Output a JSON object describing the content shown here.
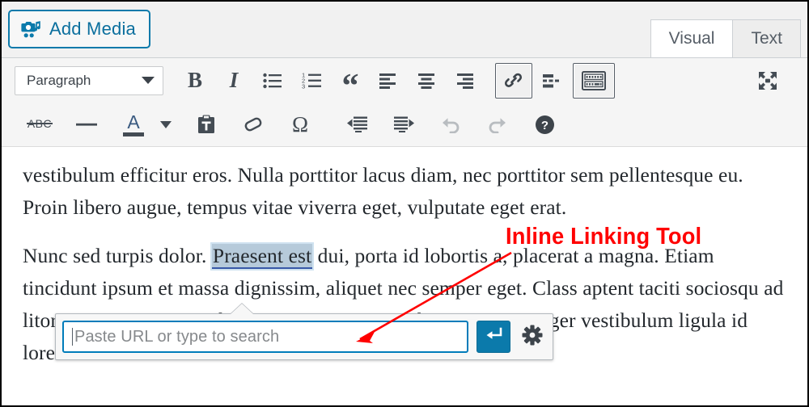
{
  "window": {
    "app": "WordPress Classic Editor"
  },
  "topbar": {
    "add_media_label": "Add Media",
    "add_media_icon": "camera-music-icon",
    "accent_color": "#0b7aab",
    "tabs": [
      {
        "label": "Visual",
        "active": true
      },
      {
        "label": "Text",
        "active": false
      }
    ]
  },
  "toolbar": {
    "style_select": {
      "value": "Paragraph",
      "caret_icon": "chevron-down-icon"
    },
    "row1": [
      {
        "name": "bold-button",
        "icon": "bold-icon",
        "glyph": "B",
        "active": false
      },
      {
        "name": "italic-button",
        "icon": "italic-icon",
        "glyph": "I",
        "active": false
      },
      {
        "name": "bulleted-list-button",
        "icon": "bulleted-list-icon",
        "active": false
      },
      {
        "name": "numbered-list-button",
        "icon": "numbered-list-icon",
        "active": false
      },
      {
        "name": "blockquote-button",
        "icon": "quote-icon",
        "glyph": "“",
        "active": false
      },
      {
        "name": "align-left-button",
        "icon": "align-left-icon",
        "active": false
      },
      {
        "name": "align-center-button",
        "icon": "align-center-icon",
        "active": false
      },
      {
        "name": "align-right-button",
        "icon": "align-right-icon",
        "active": false
      },
      {
        "name": "insert-link-button",
        "icon": "link-icon",
        "active": true
      },
      {
        "name": "read-more-button",
        "icon": "read-more-icon",
        "active": false
      },
      {
        "name": "toolbar-toggle-button",
        "icon": "keyboard-toolbar-icon",
        "active": true
      },
      {
        "name": "fullscreen-button",
        "icon": "distraction-free-icon",
        "active": false
      }
    ],
    "row2": [
      {
        "name": "strikethrough-button",
        "icon": "strikethrough-icon",
        "glyph": "ABC",
        "active": false
      },
      {
        "name": "horizontal-line-button",
        "icon": "horizontal-rule-icon",
        "active": false
      },
      {
        "name": "text-color-button",
        "icon": "text-color-icon",
        "glyph": "A",
        "active": false
      },
      {
        "name": "text-color-dropdown",
        "icon": "chevron-down-icon",
        "active": false
      },
      {
        "name": "paste-as-text-button",
        "icon": "clipboard-text-icon",
        "active": false
      },
      {
        "name": "clear-formatting-button",
        "icon": "eraser-icon",
        "active": false
      },
      {
        "name": "special-character-button",
        "icon": "omega-icon",
        "glyph": "Ω",
        "active": false
      },
      {
        "name": "outdent-button",
        "icon": "outdent-icon",
        "active": false
      },
      {
        "name": "indent-button",
        "icon": "indent-icon",
        "active": false
      },
      {
        "name": "undo-button",
        "icon": "undo-icon",
        "active": false,
        "disabled": true
      },
      {
        "name": "redo-button",
        "icon": "redo-icon",
        "active": false,
        "disabled": true
      },
      {
        "name": "help-button",
        "icon": "help-circle-icon",
        "active": false
      }
    ]
  },
  "content": {
    "paragraph1_a": "vestibulum efficitur eros. Nulla porttitor lacus diam, nec porttitor sem pellentesque eu. Proin libero augue, tempus vitae viverra eget, vulputate eget erat.",
    "paragraph2_before": "Nunc sed turpis dolor. ",
    "paragraph2_selected": "Praesent est",
    "paragraph2_after": " dui, porta id lobortis a, placerat a magna. Etiam tincidunt ipsum et massa dignissim, aliquet nec semper eget. Class aptent taciti sociosqu ad litora torquent per conubia nostra, per inceptos himenaeos. Integer vestibulum ligula id lorem"
  },
  "link_popup": {
    "url_placeholder": "Paste URL or type to search",
    "url_value": "",
    "submit_icon": "enter-return-icon",
    "settings_icon": "gear-icon",
    "submit_color": "#0b7aab",
    "field_border_color": "#007cba"
  },
  "annotation": {
    "text": "Inline Linking Tool",
    "color": "#ff0000",
    "arrow": "red-arrow-pointing-to-url-field"
  }
}
